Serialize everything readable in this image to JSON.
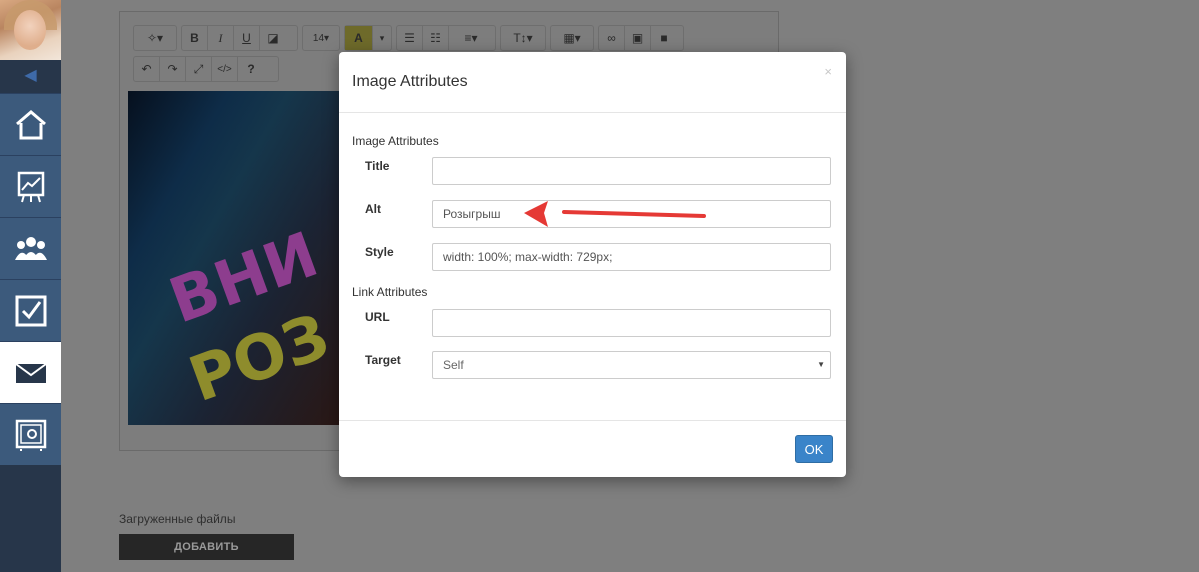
{
  "sidebar": {
    "items": [
      {
        "icon": "home-icon"
      },
      {
        "icon": "chart-icon"
      },
      {
        "icon": "users-icon"
      },
      {
        "icon": "checkbox-icon"
      },
      {
        "icon": "mail-icon",
        "active": true
      },
      {
        "icon": "safe-icon"
      }
    ]
  },
  "toolbar": {
    "font_size": "14",
    "row1": [
      "magic-icon",
      "bold",
      "italic",
      "underline",
      "eraser",
      "font-size",
      "color",
      "ul-list",
      "ol-list",
      "align",
      "text-height",
      "table",
      "link",
      "image",
      "video"
    ],
    "row2": [
      "undo",
      "redo",
      "fullscreen",
      "code",
      "help"
    ],
    "bold": "B",
    "italic": "I",
    "underline": "U",
    "help": "?",
    "code": "</>",
    "color": "A"
  },
  "page": {
    "uploaded_files": "Загруженные файлы",
    "add_button": "ДОБАВИТЬ"
  },
  "modal": {
    "title": "Image Attributes",
    "close": "×",
    "image_section": "Image Attributes",
    "link_section": "Link Attributes",
    "fields": {
      "title": {
        "label": "Title",
        "value": ""
      },
      "alt": {
        "label": "Alt",
        "value": "Розыгрыш"
      },
      "style": {
        "label": "Style",
        "value": "width: 100%; max-width: 729px;"
      },
      "url": {
        "label": "URL",
        "value": ""
      },
      "target": {
        "label": "Target",
        "value": "Self"
      }
    },
    "ok": "OK"
  },
  "colors": {
    "sidebar": "#27364a",
    "sidebar_item": "#3c5a7c",
    "primary": "#3a84c9",
    "arrow": "#e53935"
  }
}
